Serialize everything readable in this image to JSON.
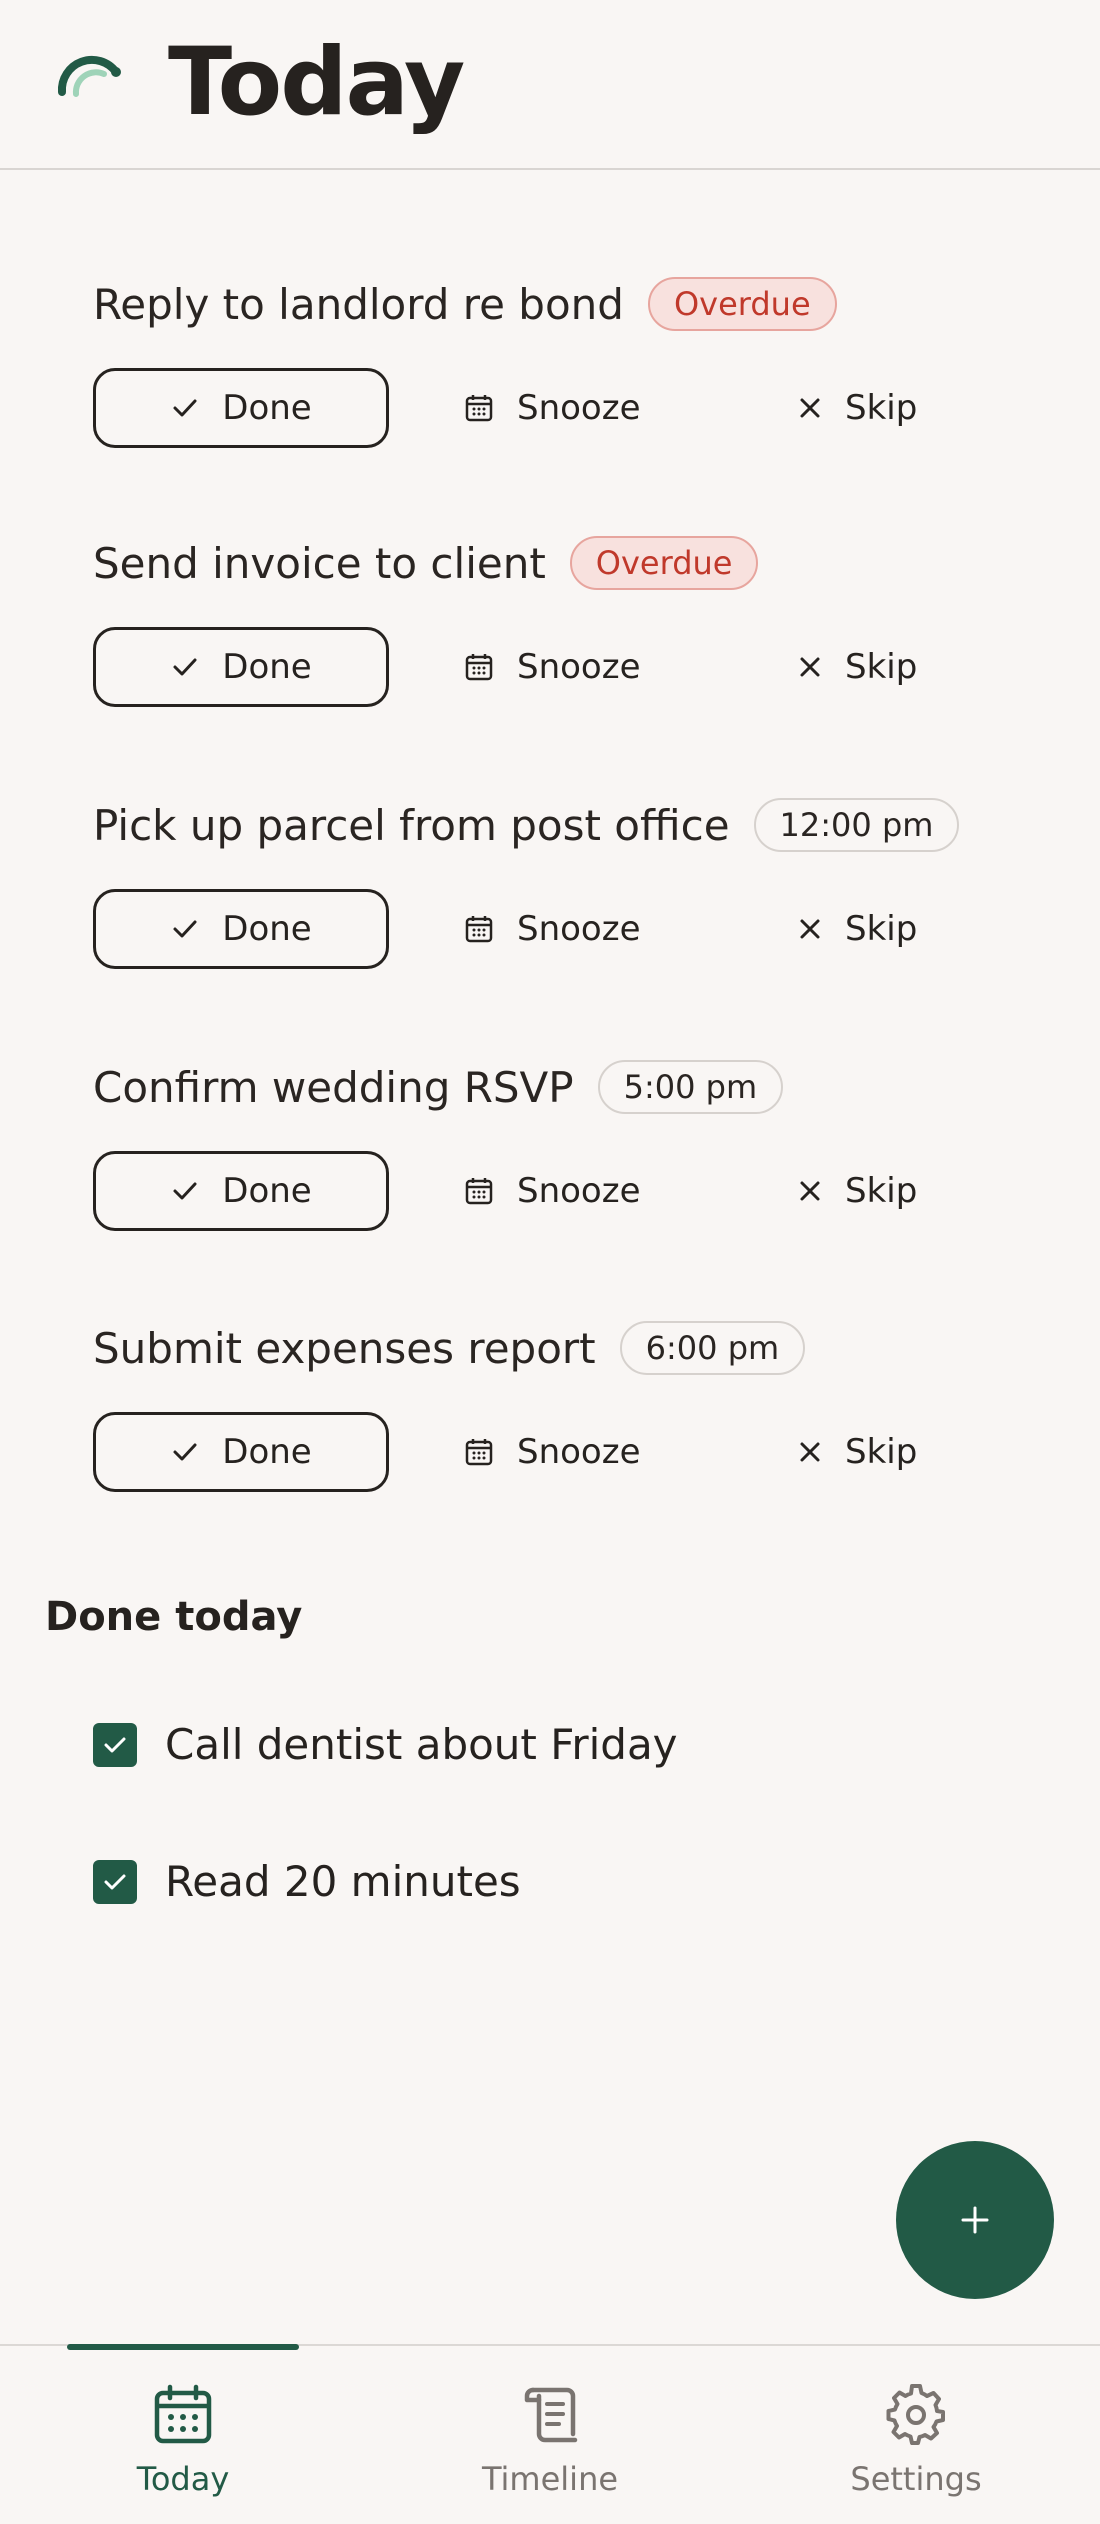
{
  "header": {
    "title": "Today",
    "logo_icon": "arc-logo-icon"
  },
  "tasks": [
    {
      "title": "Reply to landlord re bond",
      "badge": "Overdue",
      "badge_type": "overdue",
      "done_label": "Done",
      "snooze_label": "Snooze",
      "skip_label": "Skip"
    },
    {
      "title": "Send invoice to client",
      "badge": "Overdue",
      "badge_type": "overdue",
      "done_label": "Done",
      "snooze_label": "Snooze",
      "skip_label": "Skip"
    },
    {
      "title": "Pick up parcel from post office",
      "badge": "12:00 pm",
      "badge_type": "time",
      "done_label": "Done",
      "snooze_label": "Snooze",
      "skip_label": "Skip"
    },
    {
      "title": "Confirm wedding RSVP",
      "badge": "5:00 pm",
      "badge_type": "time",
      "done_label": "Done",
      "snooze_label": "Snooze",
      "skip_label": "Skip"
    },
    {
      "title": "Submit expenses report",
      "badge": "6:00 pm",
      "badge_type": "time",
      "done_label": "Done",
      "snooze_label": "Snooze",
      "skip_label": "Skip"
    }
  ],
  "done_section": {
    "title": "Done today",
    "items": [
      {
        "label": "Call dentist about Friday",
        "checked": true
      },
      {
        "label": "Read 20 minutes",
        "checked": true
      }
    ]
  },
  "fab": {
    "icon": "plus-icon"
  },
  "nav": {
    "items": [
      {
        "label": "Today",
        "icon": "calendar-icon",
        "active": true
      },
      {
        "label": "Timeline",
        "icon": "scroll-icon",
        "active": false
      },
      {
        "label": "Settings",
        "icon": "gear-icon",
        "active": false
      }
    ]
  },
  "colors": {
    "accent": "#225a46",
    "background": "#f9f6f4",
    "text": "#26221f",
    "overdue_text": "#c0392b",
    "overdue_bg": "#f8e1de"
  }
}
